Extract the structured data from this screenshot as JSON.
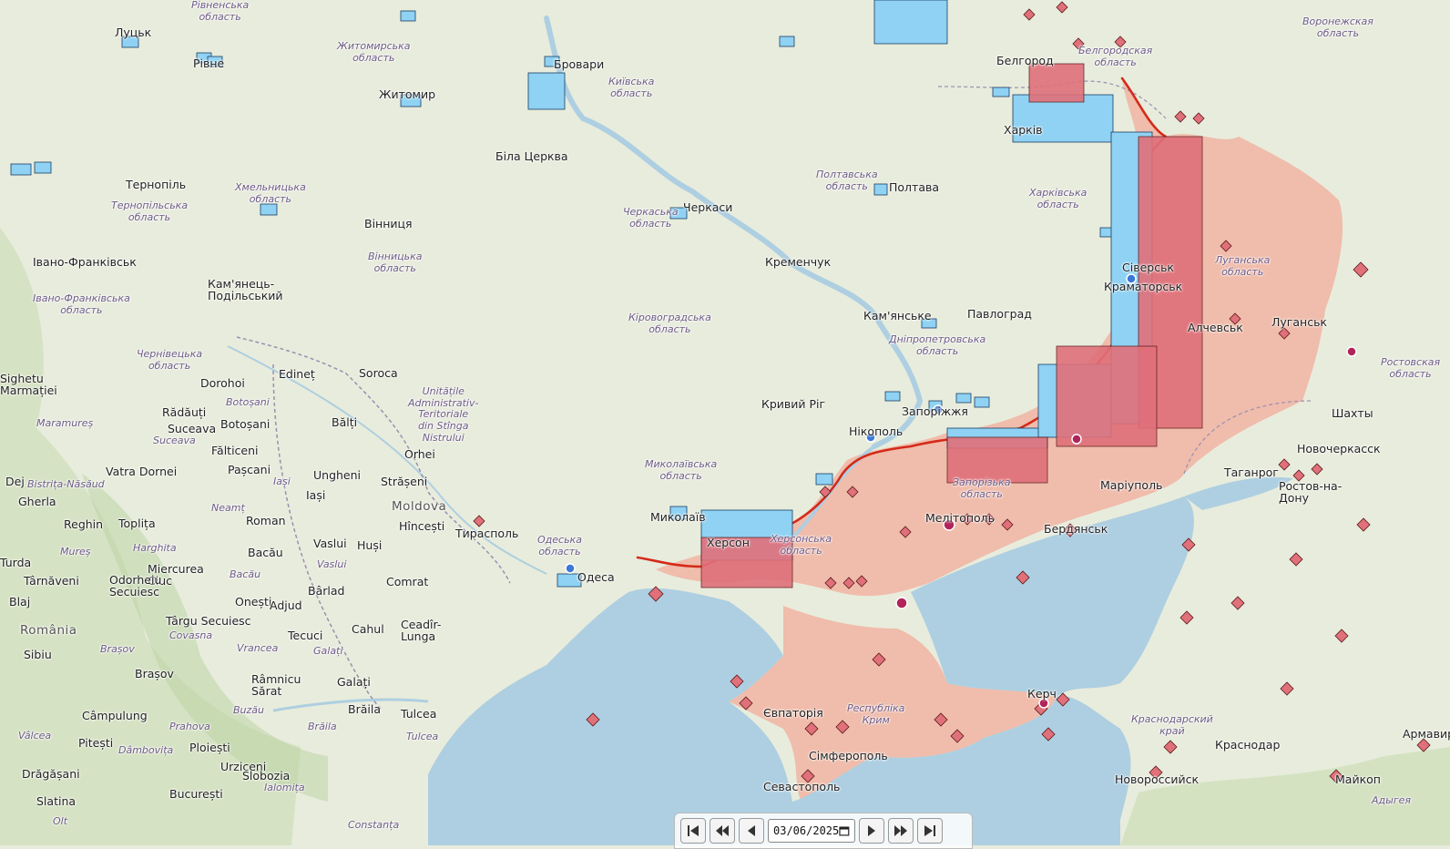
{
  "map": {
    "colors": {
      "land": "#e8ecdc",
      "water": "#aecfe1",
      "occupied": "#f0b7a6",
      "frontline": "#d42a1a",
      "ua_unit": "#8fd2f3",
      "ru_unit": "#e0707a"
    },
    "cities": [
      {
        "name": "Луцьк"
      },
      {
        "name": "Рівне"
      },
      {
        "name": "Житомир"
      },
      {
        "name": "Бровари"
      },
      {
        "name": "Біла Церква"
      },
      {
        "name": "Тернопіль"
      },
      {
        "name": "Вінниця"
      },
      {
        "name": "Івано-Франківськ"
      },
      {
        "name": "Кам'янець-Подільський"
      },
      {
        "name": "Черкаси"
      },
      {
        "name": "Полтава"
      },
      {
        "name": "Кременчук"
      },
      {
        "name": "Кам'янське"
      },
      {
        "name": "Павлоград"
      },
      {
        "name": "Кривий Ріг"
      },
      {
        "name": "Запоріжжя"
      },
      {
        "name": "Нікополь"
      },
      {
        "name": "Миколаїв"
      },
      {
        "name": "Херсон"
      },
      {
        "name": "Одеса"
      },
      {
        "name": "Тирасполь"
      },
      {
        "name": "Белгород"
      },
      {
        "name": "Харків"
      },
      {
        "name": "Луганськ"
      },
      {
        "name": "Алчевськ"
      },
      {
        "name": "Маріуполь"
      },
      {
        "name": "Мелітополь"
      },
      {
        "name": "Бердянськ"
      },
      {
        "name": "Таганрог"
      },
      {
        "name": "Ростов-на-Дону"
      },
      {
        "name": "Новочеркасск"
      },
      {
        "name": "Шахты"
      },
      {
        "name": "Євпаторія"
      },
      {
        "name": "Сімферополь"
      },
      {
        "name": "Севастополь"
      },
      {
        "name": "Керч"
      },
      {
        "name": "Краснодар"
      },
      {
        "name": "Новороссийск"
      },
      {
        "name": "Майкоп"
      },
      {
        "name": "Армавир"
      },
      {
        "name": "Краматорськ"
      },
      {
        "name": "Сіверськ"
      },
      {
        "name": "Edineț"
      },
      {
        "name": "Soroca"
      },
      {
        "name": "Bălți"
      },
      {
        "name": "Orhei"
      },
      {
        "name": "Ungheni"
      },
      {
        "name": "Strășeni"
      },
      {
        "name": "Hîncești"
      },
      {
        "name": "Comrat"
      },
      {
        "name": "Cahul"
      },
      {
        "name": "Ceadîr-Lunga"
      },
      {
        "name": "Vaslui"
      },
      {
        "name": "Huși"
      },
      {
        "name": "Bârlad"
      },
      {
        "name": "Tecuci"
      },
      {
        "name": "Galați"
      },
      {
        "name": "Brăila"
      },
      {
        "name": "Tulcea"
      },
      {
        "name": "Iași"
      },
      {
        "name": "Roman"
      },
      {
        "name": "Bacău"
      },
      {
        "name": "Onești"
      },
      {
        "name": "Adjud"
      },
      {
        "name": "Dorohoi"
      },
      {
        "name": "Botoșani"
      },
      {
        "name": "Rădăuți"
      },
      {
        "name": "Suceava"
      },
      {
        "name": "Fălticeni"
      },
      {
        "name": "Pașcani"
      },
      {
        "name": "Vatra Dornei"
      },
      {
        "name": "Toplița"
      },
      {
        "name": "Reghin"
      },
      {
        "name": "Gherla"
      },
      {
        "name": "Miercurea Ciuc"
      },
      {
        "name": "Odorheiu Secuiesc"
      },
      {
        "name": "Târgu Secuiesc"
      },
      {
        "name": "Târnăveni"
      },
      {
        "name": "Sighetu Marmației"
      },
      {
        "name": "Brașov"
      },
      {
        "name": "Sibiu"
      },
      {
        "name": "Câmpulung"
      },
      {
        "name": "Pitești"
      },
      {
        "name": "Ploiești"
      },
      {
        "name": "Urziceni"
      },
      {
        "name": "Slobozia"
      },
      {
        "name": "București"
      },
      {
        "name": "Drăgășani"
      },
      {
        "name": "Slatina"
      },
      {
        "name": "Râmnicu Sărat"
      },
      {
        "name": "Blaj"
      },
      {
        "name": "Dej"
      },
      {
        "name": "Turda"
      }
    ],
    "regions": [
      {
        "name": "Рівненська область"
      },
      {
        "name": "Житомирська область"
      },
      {
        "name": "Київська область"
      },
      {
        "name": "Хмельницька область"
      },
      {
        "name": "Тернопільська область"
      },
      {
        "name": "Вінницька область"
      },
      {
        "name": "Івано-Франківська область"
      },
      {
        "name": "Чернівецька область"
      },
      {
        "name": "Черкаська область"
      },
      {
        "name": "Полтавська область"
      },
      {
        "name": "Кіровоградська область"
      },
      {
        "name": "Дніпропетровська область"
      },
      {
        "name": "Харківська область"
      },
      {
        "name": "Луганська область"
      },
      {
        "name": "Запорізька область"
      },
      {
        "name": "Миколаївська область"
      },
      {
        "name": "Одеська область"
      },
      {
        "name": "Херсонська область"
      },
      {
        "name": "Республіка Крим"
      },
      {
        "name": "Белгородская область"
      },
      {
        "name": "Воронежская область"
      },
      {
        "name": "Ростовская область"
      },
      {
        "name": "Краснодарский край"
      },
      {
        "name": "Адыгея"
      },
      {
        "name": "Unitățile Administrativ-Teritoriale din Stînga Nistrului"
      },
      {
        "name": "Botoșani"
      },
      {
        "name": "Suceava"
      },
      {
        "name": "Maramureș"
      },
      {
        "name": "Bistrița-Năsăud"
      },
      {
        "name": "Iași"
      },
      {
        "name": "Neamț"
      },
      {
        "name": "Mureș"
      },
      {
        "name": "Harghita"
      },
      {
        "name": "Bacău"
      },
      {
        "name": "Vaslui"
      },
      {
        "name": "Covasna"
      },
      {
        "name": "Vrancea"
      },
      {
        "name": "Galați"
      },
      {
        "name": "Brașov"
      },
      {
        "name": "Buzău"
      },
      {
        "name": "Brăila"
      },
      {
        "name": "Tulcea"
      },
      {
        "name": "Prahova"
      },
      {
        "name": "Ialomița"
      },
      {
        "name": "Dâmbovița"
      },
      {
        "name": "Vâlcea"
      },
      {
        "name": "Olt"
      },
      {
        "name": "Constanța"
      }
    ],
    "countries": [
      {
        "name": "Moldova"
      },
      {
        "name": "România"
      }
    ]
  },
  "controls": {
    "first_label": "first",
    "prev_fast_label": "back",
    "prev_label": "previous",
    "date_value": "03/06/2025",
    "next_label": "next",
    "next_fast_label": "forward",
    "last_label": "last"
  }
}
